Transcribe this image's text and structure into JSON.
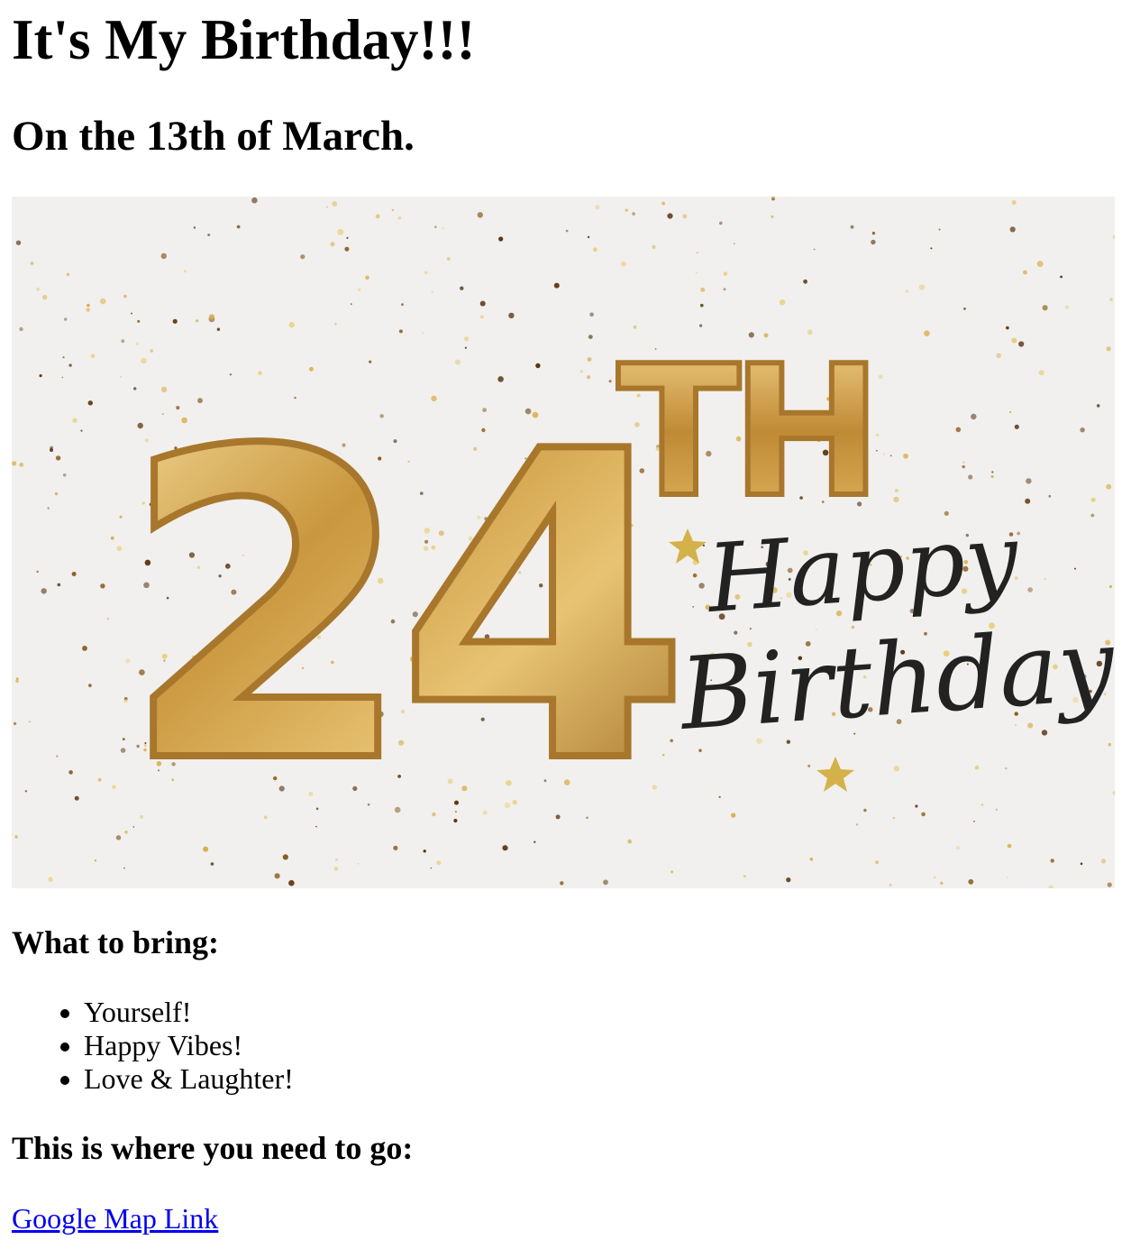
{
  "header": {
    "title": "It's My Birthday!!!",
    "date_line": "On the 13th of March."
  },
  "hero_image": {
    "number_text": "24",
    "ordinal_text": "TH",
    "greeting_line_1": "Happy",
    "greeting_line_2": "Birthday",
    "balloon_color": "#c9973e",
    "balloon_highlight": "#f6dfa0",
    "background_color": "#f1f0ee",
    "confetti_color": "#d9b04e"
  },
  "bring_section": {
    "heading": "What to bring:",
    "items": [
      "Yourself!",
      "Happy Vibes!",
      "Love & Laughter!"
    ]
  },
  "location_section": {
    "heading": "This is where you need to go:",
    "link_label": "Google Map Link",
    "link_color": "#0000ee"
  }
}
